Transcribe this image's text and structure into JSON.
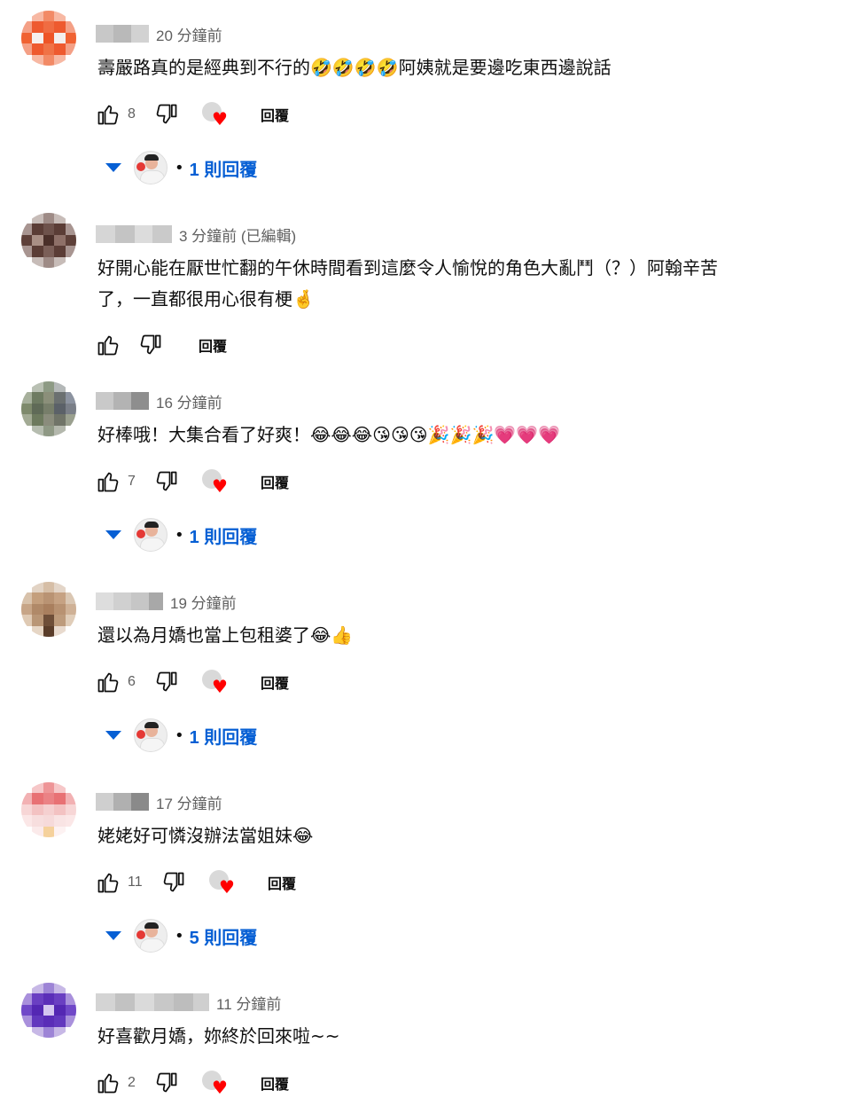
{
  "comments": [
    {
      "time": "20 分鐘前",
      "text": "壽嚴路真的是經典到不行的🤣🤣🤣🤣阿姨就是要邊吃東西邊說話",
      "likes": "8",
      "reply_label": "回覆",
      "replies_label": "1 則回覆",
      "has_creator_heart": true
    },
    {
      "time": "3 分鐘前 (已編輯)",
      "text": "好開心能在厭世忙翻的午休時間看到這麼令人愉悅的角色大亂鬥（？）阿翰辛苦\n了，一直都很用心很有梗🤞",
      "likes": "",
      "reply_label": "回覆",
      "has_creator_heart": false
    },
    {
      "time": "16 分鐘前",
      "text": "好棒哦！大集合看了好爽！😂😂😂😘😘😘🎉🎉🎉💗💗💗",
      "likes": "7",
      "reply_label": "回覆",
      "replies_label": "1 則回覆",
      "has_creator_heart": true
    },
    {
      "time": "19 分鐘前",
      "text": "還以為月嬌也當上包租婆了😂👍",
      "likes": "6",
      "reply_label": "回覆",
      "replies_label": "1 則回覆",
      "has_creator_heart": true
    },
    {
      "time": "17 分鐘前",
      "text": "姥姥好可憐沒辦法當姐妹😂",
      "likes": "11",
      "reply_label": "回覆",
      "replies_label": "5 則回覆",
      "has_creator_heart": true
    },
    {
      "time": "11 分鐘前",
      "text": "好喜歡月嬌，妳終於回來啦~~",
      "likes": "2",
      "reply_label": "回覆",
      "has_creator_heart": true
    }
  ],
  "icons": {
    "like": "thumb-up-icon",
    "dislike": "thumb-down-icon",
    "heart": "creator-heart-icon",
    "expand": "caret-down-icon"
  },
  "colors": {
    "link_blue": "#065fd4",
    "heart_red": "#ff0000",
    "secondary_text": "#606060"
  }
}
